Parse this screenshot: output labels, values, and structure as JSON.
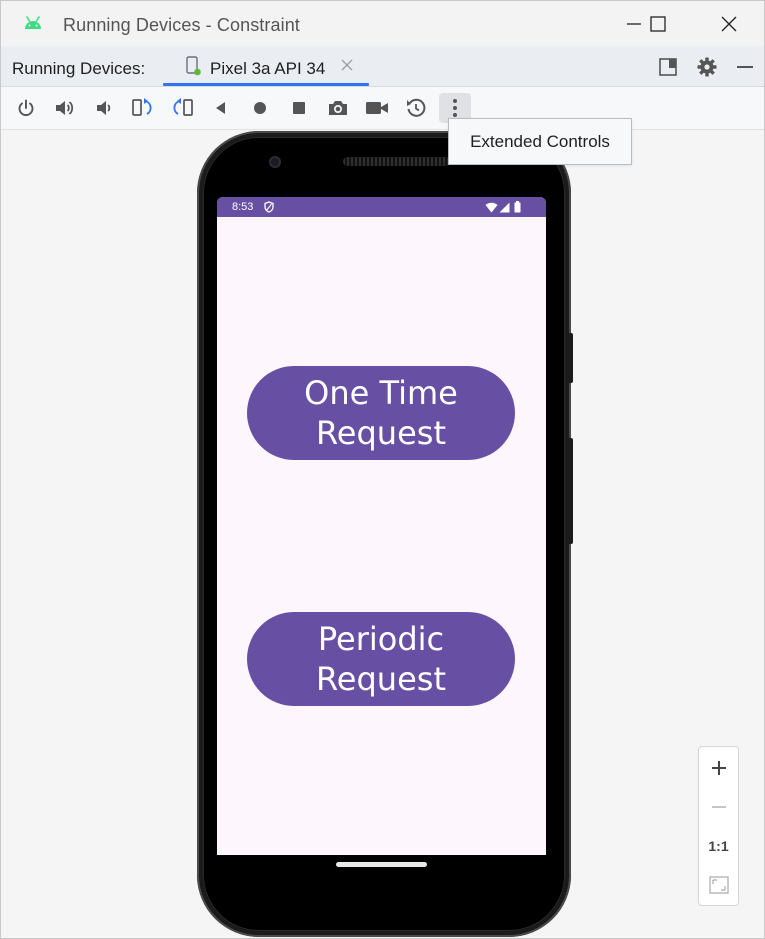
{
  "window": {
    "title": "Running Devices - Constraint",
    "accent_color": "#3574f0"
  },
  "tabbar": {
    "label": "Running Devices:",
    "device_tab": {
      "label": "Pixel 3a API 34",
      "close_icon": "close-icon"
    }
  },
  "toolbar": {
    "buttons": [
      {
        "name": "power-icon"
      },
      {
        "name": "volume-up-icon"
      },
      {
        "name": "volume-down-icon"
      },
      {
        "name": "rotate-left-icon"
      },
      {
        "name": "rotate-right-icon"
      },
      {
        "name": "back-icon"
      },
      {
        "name": "home-icon"
      },
      {
        "name": "overview-icon"
      },
      {
        "name": "screenshot-icon"
      },
      {
        "name": "screen-record-icon"
      },
      {
        "name": "snapshot-icon"
      },
      {
        "name": "more-options-icon"
      }
    ],
    "tooltip": "Extended Controls"
  },
  "device_screen": {
    "status_time": "8:53",
    "status_color": "#6750a4",
    "background": "#fdf7fd",
    "buttons": [
      {
        "label": "One Time\nRequest"
      },
      {
        "label": "Periodic\nRequest"
      }
    ]
  },
  "zoom_controls": {
    "zoom_in": "+",
    "zoom_out": "−",
    "actual_size": "1:1"
  }
}
